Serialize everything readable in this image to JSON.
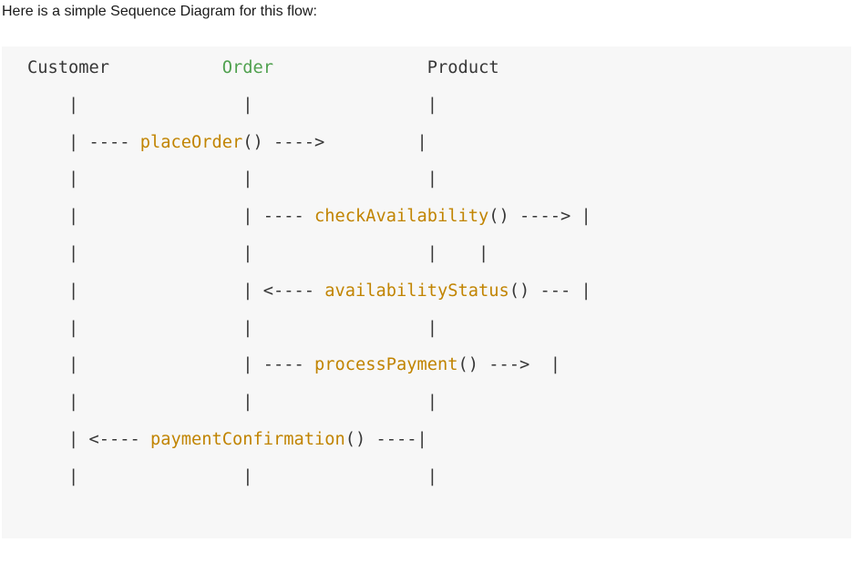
{
  "intro_text": "Here is a simple Sequence Diagram for this flow:",
  "colors": {
    "plain": "#383838",
    "function": "#c18401",
    "highlight": "#50a14f",
    "code_background": "#f7f7f7"
  },
  "code_lines": [
    [
      {
        "t": "Customer           ",
        "c": "plain"
      },
      {
        "t": "Order",
        "c": "green"
      },
      {
        "t": "               Product",
        "c": "plain"
      }
    ],
    [
      {
        "t": "    |                |                 |",
        "c": "plain"
      }
    ],
    [
      {
        "t": "    | ---- ",
        "c": "plain"
      },
      {
        "t": "placeOrder",
        "c": "func"
      },
      {
        "t": "() ---->         |",
        "c": "plain"
      }
    ],
    [
      {
        "t": "    |                |                 |",
        "c": "plain"
      }
    ],
    [
      {
        "t": "    |                | ---- ",
        "c": "plain"
      },
      {
        "t": "checkAvailability",
        "c": "func"
      },
      {
        "t": "() ----> |",
        "c": "plain"
      }
    ],
    [
      {
        "t": "    |                |                 |    |",
        "c": "plain"
      }
    ],
    [
      {
        "t": "    |                | <---- ",
        "c": "plain"
      },
      {
        "t": "availabilityStatus",
        "c": "func"
      },
      {
        "t": "() --- |",
        "c": "plain"
      }
    ],
    [
      {
        "t": "    |                |                 |",
        "c": "plain"
      }
    ],
    [
      {
        "t": "    |                | ---- ",
        "c": "plain"
      },
      {
        "t": "processPayment",
        "c": "func"
      },
      {
        "t": "() --->  |",
        "c": "plain"
      }
    ],
    [
      {
        "t": "    |                |                 |",
        "c": "plain"
      }
    ],
    [
      {
        "t": "    | <---- ",
        "c": "plain"
      },
      {
        "t": "paymentConfirmation",
        "c": "func"
      },
      {
        "t": "() ----|",
        "c": "plain"
      }
    ],
    [
      {
        "t": "    |                |                 |",
        "c": "plain"
      }
    ]
  ]
}
